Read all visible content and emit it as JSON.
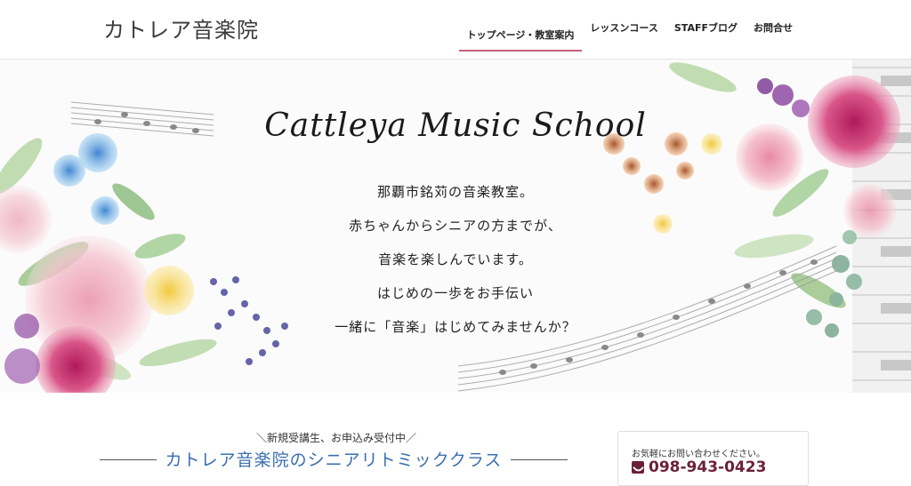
{
  "site": {
    "title": "カトレア音楽院"
  },
  "nav": {
    "items": [
      {
        "label": "トップページ・教室案内",
        "active": true
      },
      {
        "label": "レッスンコース",
        "active": false
      },
      {
        "label": "STAFFブログ",
        "active": false
      },
      {
        "label": "お問合せ",
        "active": false
      }
    ]
  },
  "hero": {
    "title": "Cattleya Music School",
    "lines": [
      "那覇市銘苅の音楽教室。",
      "赤ちゃんからシニアの方までが、",
      "音楽を楽しんでいます。",
      "はじめの一歩をお手伝い",
      "一緒に「音楽」はじめてみませんか？"
    ]
  },
  "section": {
    "notice": "＼新規受講生、お申込み受付中／",
    "class_title": "カトレア音楽院のシニアリトミッククラス"
  },
  "contact": {
    "label": "お気軽にお問い合わせください。",
    "phone": "098-943-0423",
    "icon": "phone-icon"
  },
  "colors": {
    "accent_nav": "#c46478",
    "class_title": "#3a6fb0",
    "phone": "#6b1f39"
  }
}
